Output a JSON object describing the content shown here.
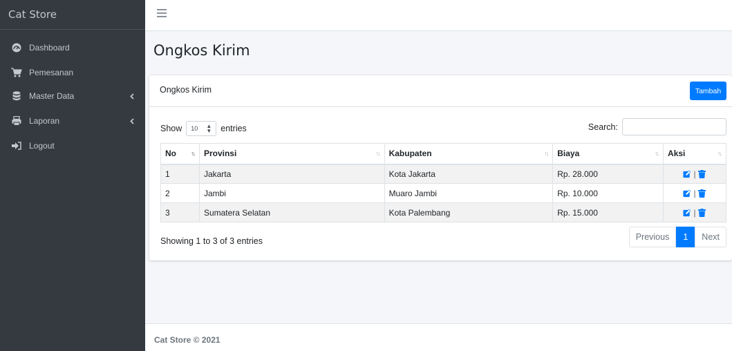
{
  "app": {
    "brand": "Cat Store"
  },
  "sidebar": {
    "items": [
      {
        "label": "Dashboard",
        "icon": "dashboard-icon"
      },
      {
        "label": "Pemesanan",
        "icon": "cart-icon"
      },
      {
        "label": "Master Data",
        "icon": "database-icon",
        "expandable": true
      },
      {
        "label": "Laporan",
        "icon": "printer-icon",
        "expandable": true
      },
      {
        "label": "Logout",
        "icon": "logout-icon"
      }
    ]
  },
  "page": {
    "title": "Ongkos Kirim"
  },
  "card": {
    "title": "Ongkos Kirim",
    "add_label": "Tambah"
  },
  "table_controls": {
    "show_label": "Show",
    "length_value": "10",
    "entries_label": "entries",
    "search_label": "Search:",
    "search_value": ""
  },
  "table": {
    "columns": [
      "No",
      "Provinsi",
      "Kabupaten",
      "Biaya",
      "Aksi"
    ],
    "rows": [
      {
        "no": "1",
        "provinsi": "Jakarta",
        "kabupaten": "Kota Jakarta",
        "biaya": "Rp. 28.000"
      },
      {
        "no": "2",
        "provinsi": "Jambi",
        "kabupaten": "Muaro Jambi",
        "biaya": "Rp. 10.000"
      },
      {
        "no": "3",
        "provinsi": "Sumatera Selatan",
        "kabupaten": "Kota Palembang",
        "biaya": "Rp. 15.000"
      }
    ]
  },
  "pagination": {
    "info": "Showing 1 to 3 of 3 entries",
    "previous": "Previous",
    "current": "1",
    "next": "Next"
  },
  "footer": {
    "text": "Cat Store © 2021"
  },
  "colors": {
    "primary": "#007bff",
    "sidebar": "#343a40",
    "sidebar_text": "#c2c7d0"
  }
}
